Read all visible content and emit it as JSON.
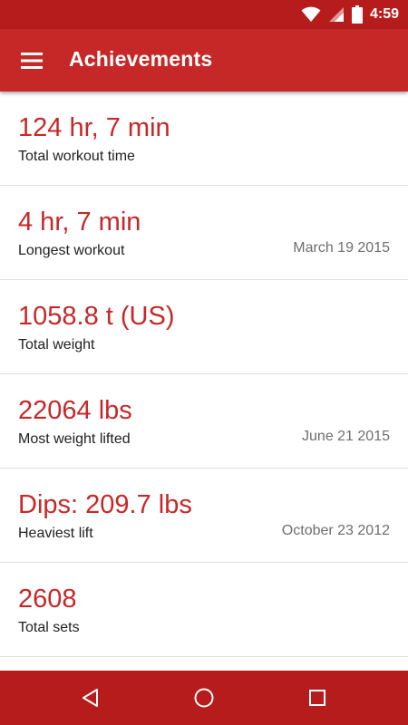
{
  "status": {
    "time": "4:59"
  },
  "appbar": {
    "title": "Achievements"
  },
  "achievements": [
    {
      "value": "124 hr, 7 min",
      "label": "Total workout time",
      "date": ""
    },
    {
      "value": "4 hr, 7 min",
      "label": "Longest workout",
      "date": "March 19 2015"
    },
    {
      "value": "1058.8 t (US)",
      "label": "Total weight",
      "date": ""
    },
    {
      "value": "22064 lbs",
      "label": "Most weight lifted",
      "date": "June 21 2015"
    },
    {
      "value": "Dips: 209.7 lbs",
      "label": "Heaviest lift",
      "date": "October 23 2012"
    },
    {
      "value": "2608",
      "label": "Total sets",
      "date": ""
    }
  ],
  "icons": {
    "wifi": "wifi-icon",
    "signal": "signal-icon",
    "battery": "battery-icon",
    "menu": "hamburger-menu-icon",
    "back": "back-triangle-icon",
    "home": "home-circle-icon",
    "recents": "recents-square-icon"
  },
  "colors": {
    "primary": "#c62828",
    "primary_dark": "#b71c1c",
    "value_text": "#c62828"
  }
}
